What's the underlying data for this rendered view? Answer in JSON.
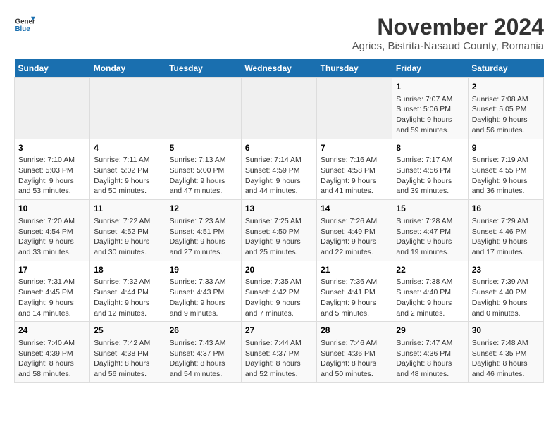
{
  "logo": {
    "line1": "General",
    "line2": "Blue"
  },
  "title": "November 2024",
  "subtitle": "Agries, Bistrita-Nasaud County, Romania",
  "days_of_week": [
    "Sunday",
    "Monday",
    "Tuesday",
    "Wednesday",
    "Thursday",
    "Friday",
    "Saturday"
  ],
  "weeks": [
    [
      {
        "day": "",
        "content": ""
      },
      {
        "day": "",
        "content": ""
      },
      {
        "day": "",
        "content": ""
      },
      {
        "day": "",
        "content": ""
      },
      {
        "day": "",
        "content": ""
      },
      {
        "day": "1",
        "content": "Sunrise: 7:07 AM\nSunset: 5:06 PM\nDaylight: 9 hours and 59 minutes."
      },
      {
        "day": "2",
        "content": "Sunrise: 7:08 AM\nSunset: 5:05 PM\nDaylight: 9 hours and 56 minutes."
      }
    ],
    [
      {
        "day": "3",
        "content": "Sunrise: 7:10 AM\nSunset: 5:03 PM\nDaylight: 9 hours and 53 minutes."
      },
      {
        "day": "4",
        "content": "Sunrise: 7:11 AM\nSunset: 5:02 PM\nDaylight: 9 hours and 50 minutes."
      },
      {
        "day": "5",
        "content": "Sunrise: 7:13 AM\nSunset: 5:00 PM\nDaylight: 9 hours and 47 minutes."
      },
      {
        "day": "6",
        "content": "Sunrise: 7:14 AM\nSunset: 4:59 PM\nDaylight: 9 hours and 44 minutes."
      },
      {
        "day": "7",
        "content": "Sunrise: 7:16 AM\nSunset: 4:58 PM\nDaylight: 9 hours and 41 minutes."
      },
      {
        "day": "8",
        "content": "Sunrise: 7:17 AM\nSunset: 4:56 PM\nDaylight: 9 hours and 39 minutes."
      },
      {
        "day": "9",
        "content": "Sunrise: 7:19 AM\nSunset: 4:55 PM\nDaylight: 9 hours and 36 minutes."
      }
    ],
    [
      {
        "day": "10",
        "content": "Sunrise: 7:20 AM\nSunset: 4:54 PM\nDaylight: 9 hours and 33 minutes."
      },
      {
        "day": "11",
        "content": "Sunrise: 7:22 AM\nSunset: 4:52 PM\nDaylight: 9 hours and 30 minutes."
      },
      {
        "day": "12",
        "content": "Sunrise: 7:23 AM\nSunset: 4:51 PM\nDaylight: 9 hours and 27 minutes."
      },
      {
        "day": "13",
        "content": "Sunrise: 7:25 AM\nSunset: 4:50 PM\nDaylight: 9 hours and 25 minutes."
      },
      {
        "day": "14",
        "content": "Sunrise: 7:26 AM\nSunset: 4:49 PM\nDaylight: 9 hours and 22 minutes."
      },
      {
        "day": "15",
        "content": "Sunrise: 7:28 AM\nSunset: 4:47 PM\nDaylight: 9 hours and 19 minutes."
      },
      {
        "day": "16",
        "content": "Sunrise: 7:29 AM\nSunset: 4:46 PM\nDaylight: 9 hours and 17 minutes."
      }
    ],
    [
      {
        "day": "17",
        "content": "Sunrise: 7:31 AM\nSunset: 4:45 PM\nDaylight: 9 hours and 14 minutes."
      },
      {
        "day": "18",
        "content": "Sunrise: 7:32 AM\nSunset: 4:44 PM\nDaylight: 9 hours and 12 minutes."
      },
      {
        "day": "19",
        "content": "Sunrise: 7:33 AM\nSunset: 4:43 PM\nDaylight: 9 hours and 9 minutes."
      },
      {
        "day": "20",
        "content": "Sunrise: 7:35 AM\nSunset: 4:42 PM\nDaylight: 9 hours and 7 minutes."
      },
      {
        "day": "21",
        "content": "Sunrise: 7:36 AM\nSunset: 4:41 PM\nDaylight: 9 hours and 5 minutes."
      },
      {
        "day": "22",
        "content": "Sunrise: 7:38 AM\nSunset: 4:40 PM\nDaylight: 9 hours and 2 minutes."
      },
      {
        "day": "23",
        "content": "Sunrise: 7:39 AM\nSunset: 4:40 PM\nDaylight: 9 hours and 0 minutes."
      }
    ],
    [
      {
        "day": "24",
        "content": "Sunrise: 7:40 AM\nSunset: 4:39 PM\nDaylight: 8 hours and 58 minutes."
      },
      {
        "day": "25",
        "content": "Sunrise: 7:42 AM\nSunset: 4:38 PM\nDaylight: 8 hours and 56 minutes."
      },
      {
        "day": "26",
        "content": "Sunrise: 7:43 AM\nSunset: 4:37 PM\nDaylight: 8 hours and 54 minutes."
      },
      {
        "day": "27",
        "content": "Sunrise: 7:44 AM\nSunset: 4:37 PM\nDaylight: 8 hours and 52 minutes."
      },
      {
        "day": "28",
        "content": "Sunrise: 7:46 AM\nSunset: 4:36 PM\nDaylight: 8 hours and 50 minutes."
      },
      {
        "day": "29",
        "content": "Sunrise: 7:47 AM\nSunset: 4:36 PM\nDaylight: 8 hours and 48 minutes."
      },
      {
        "day": "30",
        "content": "Sunrise: 7:48 AM\nSunset: 4:35 PM\nDaylight: 8 hours and 46 minutes."
      }
    ]
  ]
}
